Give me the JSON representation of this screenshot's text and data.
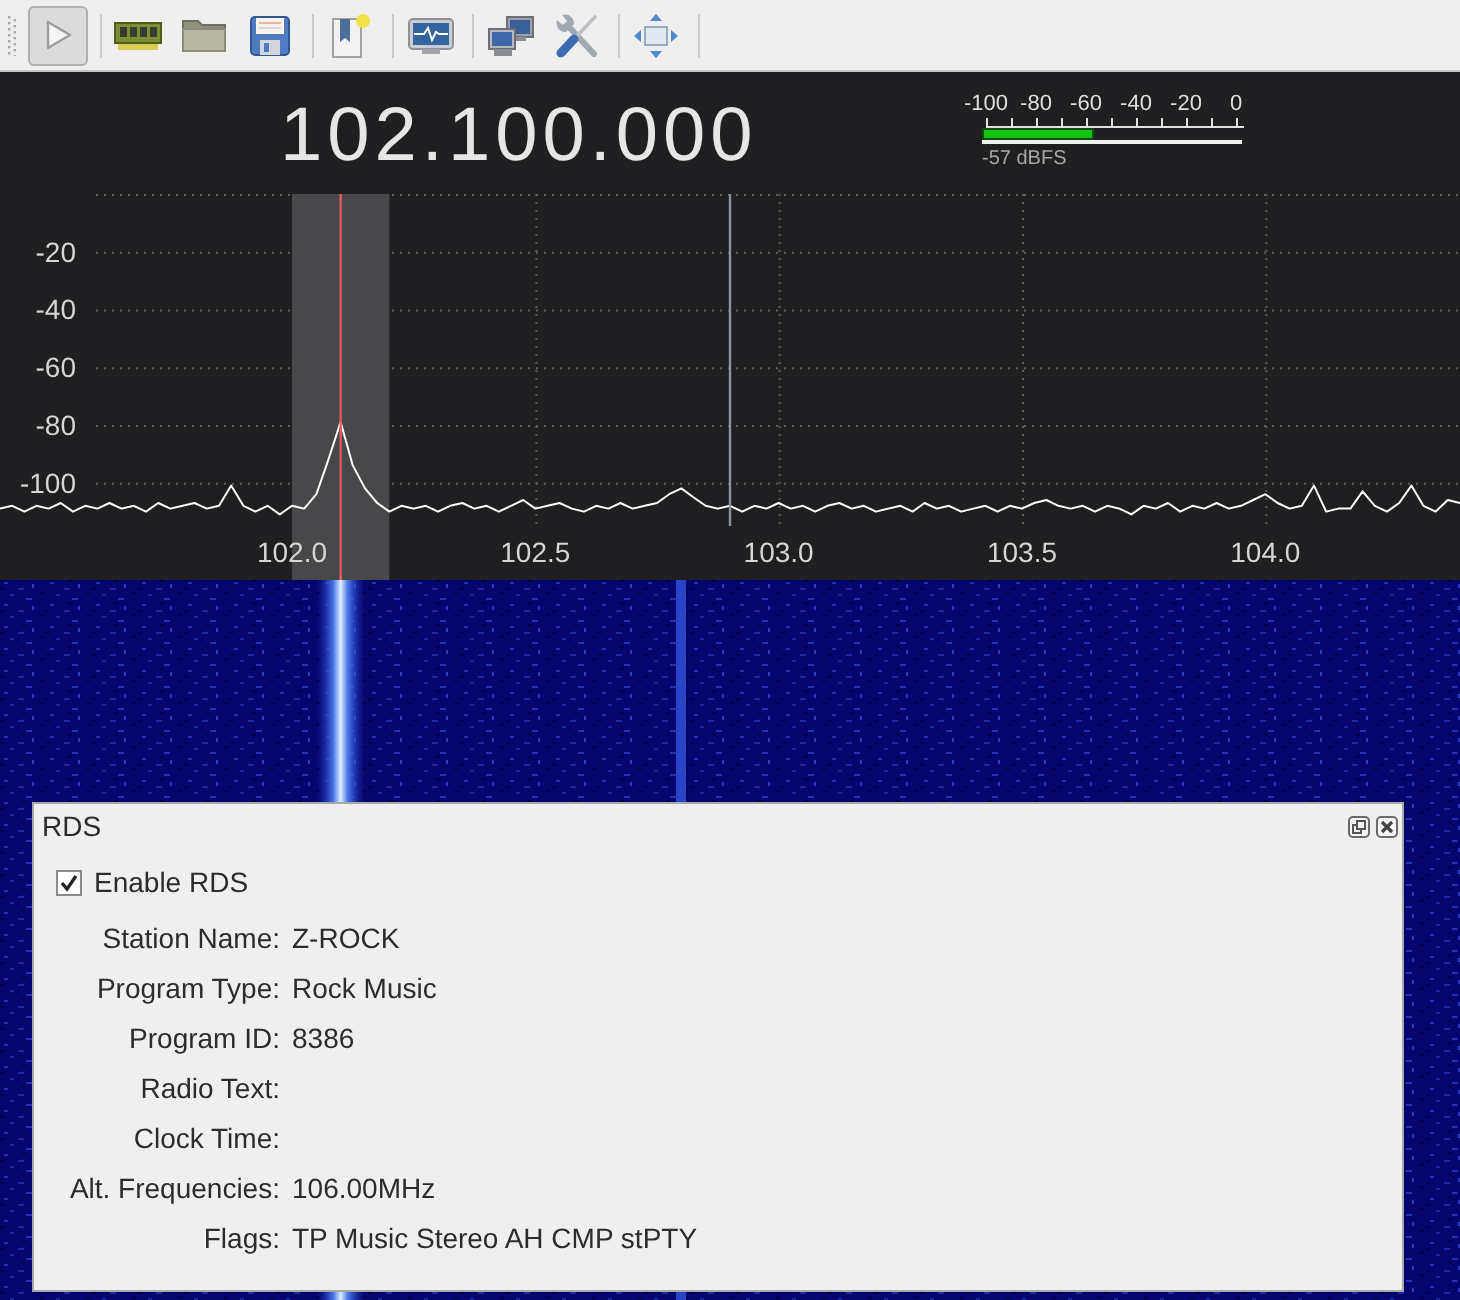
{
  "toolbar": {
    "groups": [
      {
        "buttons": [
          {
            "kind": "play",
            "pressed": true
          }
        ]
      },
      {
        "buttons": [
          {
            "kind": "device",
            "pressed": false
          },
          {
            "kind": "open",
            "pressed": false
          },
          {
            "kind": "save",
            "pressed": false
          }
        ]
      },
      {
        "buttons": [
          {
            "kind": "bookmark",
            "pressed": false
          }
        ]
      },
      {
        "buttons": [
          {
            "kind": "fft",
            "pressed": false
          }
        ]
      },
      {
        "buttons": [
          {
            "kind": "remote",
            "pressed": false
          },
          {
            "kind": "tools",
            "pressed": false
          }
        ]
      },
      {
        "buttons": [
          {
            "kind": "fullscreen",
            "pressed": false
          }
        ]
      }
    ]
  },
  "frequency_display": "102.100.000",
  "signal_meter": {
    "scale": [
      "-100",
      "-80",
      "-60",
      "-40",
      "-20",
      "0"
    ],
    "level": 0.43,
    "reading": "-57 dBFS"
  },
  "spectrum": {
    "chart_data": {
      "type": "line",
      "x": [
        101.4,
        101.425,
        101.45,
        101.475,
        101.5,
        101.525,
        101.55,
        101.575,
        101.6,
        101.625,
        101.65,
        101.675,
        101.7,
        101.725,
        101.75,
        101.775,
        101.8,
        101.825,
        101.85,
        101.875,
        101.9,
        101.925,
        101.95,
        101.975,
        102,
        102.025,
        102.05,
        102.075,
        102.1,
        102.125,
        102.15,
        102.175,
        102.2,
        102.225,
        102.25,
        102.275,
        102.3,
        102.325,
        102.35,
        102.375,
        102.4,
        102.425,
        102.45,
        102.475,
        102.5,
        102.525,
        102.55,
        102.575,
        102.6,
        102.625,
        102.65,
        102.675,
        102.7,
        102.725,
        102.75,
        102.775,
        102.8,
        102.825,
        102.85,
        102.875,
        102.9,
        102.925,
        102.95,
        102.975,
        103,
        103.025,
        103.05,
        103.075,
        103.1,
        103.125,
        103.15,
        103.175,
        103.2,
        103.225,
        103.25,
        103.275,
        103.3,
        103.325,
        103.35,
        103.375,
        103.4,
        103.425,
        103.45,
        103.475,
        103.5,
        103.525,
        103.55,
        103.575,
        103.6,
        103.625,
        103.65,
        103.675,
        103.7,
        103.725,
        103.75,
        103.775,
        103.8,
        103.825,
        103.85,
        103.875,
        103.9,
        103.925,
        103.95,
        103.975,
        104,
        104.025,
        104.05,
        104.075,
        104.1,
        104.125,
        104.15,
        104.175,
        104.2,
        104.225,
        104.25,
        104.275,
        104.3,
        104.325,
        104.35,
        104.375,
        104.4
      ],
      "values": [
        -109,
        -108,
        -110,
        -108,
        -109,
        -107,
        -110,
        -108,
        -109,
        -107,
        -109,
        -108,
        -110,
        -107,
        -109,
        -108,
        -107,
        -109,
        -108,
        -101,
        -108,
        -110,
        -108,
        -111,
        -108,
        -109,
        -104,
        -92,
        -79,
        -94,
        -102,
        -107,
        -110,
        -108,
        -109,
        -108,
        -110,
        -108,
        -107,
        -109,
        -108,
        -110,
        -108,
        -106,
        -109,
        -108,
        -107,
        -109,
        -110,
        -108,
        -109,
        -107,
        -109,
        -108,
        -107,
        -104,
        -102,
        -105,
        -108,
        -109,
        -108,
        -110,
        -108,
        -109,
        -107,
        -109,
        -108,
        -110,
        -108,
        -107,
        -109,
        -108,
        -110,
        -109,
        -108,
        -110,
        -107,
        -109,
        -108,
        -110,
        -109,
        -108,
        -110,
        -108,
        -109,
        -107,
        -106,
        -108,
        -109,
        -108,
        -110,
        -108,
        -109,
        -111,
        -108,
        -109,
        -107,
        -110,
        -108,
        -109,
        -107,
        -109,
        -108,
        -106,
        -104,
        -107,
        -109,
        -108,
        -101,
        -110,
        -109,
        -109,
        -103,
        -108,
        -110,
        -107,
        -101,
        -108,
        -110,
        -106,
        -107
      ],
      "xlim": [
        101.4,
        104.4
      ],
      "ylim": [
        -115,
        0
      ],
      "xticks": [
        {
          "value": 102,
          "label": "102.0"
        },
        {
          "value": 102.5,
          "label": "102.5"
        },
        {
          "value": 103,
          "label": "103.0"
        },
        {
          "value": 103.5,
          "label": "103.5"
        },
        {
          "value": 104,
          "label": "104.0"
        }
      ],
      "yticks": [
        -20,
        -40,
        -60,
        -80,
        -100
      ],
      "grid": true,
      "bands": [
        {
          "axis": "x",
          "from": 102.0,
          "to": 102.2
        }
      ],
      "ref_lines": [
        {
          "axis": "x",
          "value": 102.1,
          "color": "#f05a5a"
        },
        {
          "axis": "x",
          "value": 102.9,
          "color": "#8a93a0"
        }
      ]
    }
  },
  "rds_panel": {
    "title": "RDS",
    "enable": {
      "label": "Enable RDS",
      "checked": true
    },
    "fields": [
      {
        "label": "Station Name:",
        "value": "Z-ROCK"
      },
      {
        "label": "Program Type:",
        "value": "Rock Music"
      },
      {
        "label": "Program ID:",
        "value": "8386"
      },
      {
        "label": "Radio Text:"
      },
      {
        "label": "Clock Time:"
      },
      {
        "label": "Alt. Frequencies:",
        "value": "106.00MHz"
      },
      {
        "label": "Flags:",
        "value": "TP Music Stereo AH CMP stPTY"
      }
    ]
  }
}
